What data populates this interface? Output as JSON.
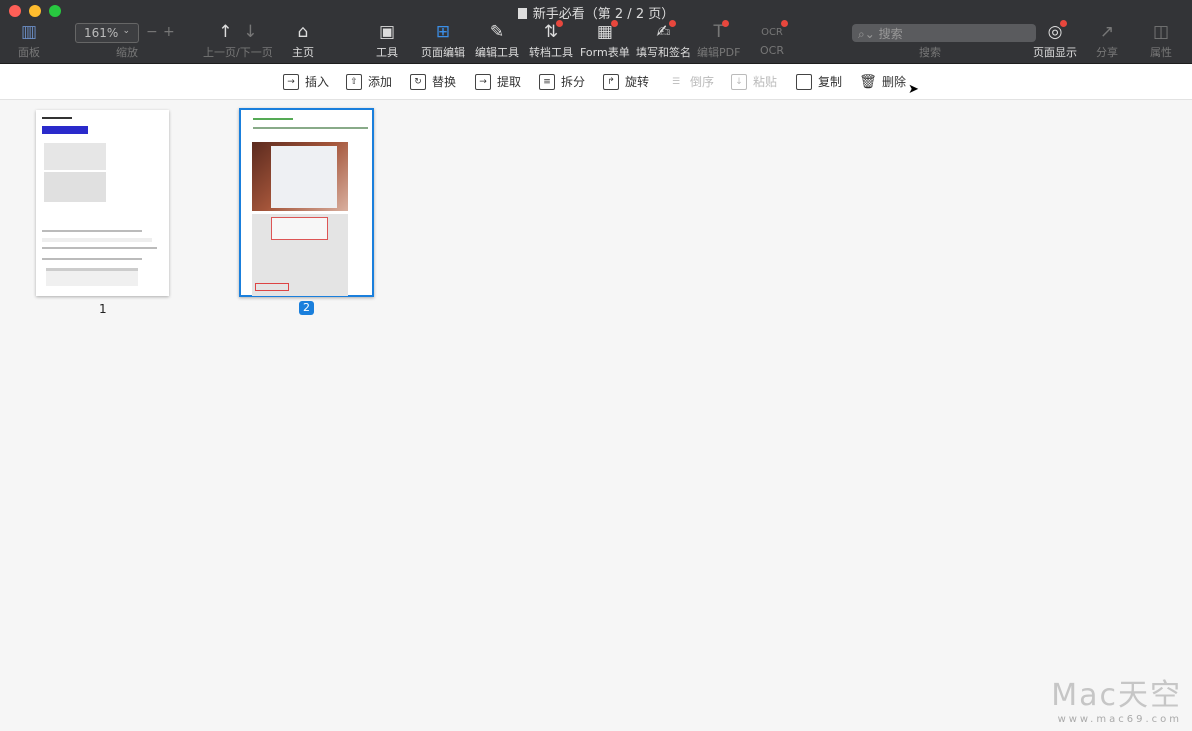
{
  "window": {
    "title": "新手必看（第 2 / 2 页）"
  },
  "toolbar": {
    "panel": "面板",
    "zoom_value": "161%",
    "zoom_label": "缩放",
    "zoom_minus": "−",
    "zoom_plus": "+",
    "prevnext": "上一页/下一页",
    "home": "主页",
    "tools": "工具",
    "page_edit": "页面编辑",
    "edit_tools": "编辑工具",
    "convert": "转档工具",
    "form": "Form表单",
    "fill_sign": "填写和签名",
    "edit_pdf": "编辑PDF",
    "ocr": "OCR",
    "search_placeholder": "搜索",
    "search_label": "搜索",
    "page_display": "页面显示",
    "share": "分享",
    "properties": "属性"
  },
  "page_tools": [
    {
      "label": "插入",
      "icon": "insert-icon",
      "enabled": true
    },
    {
      "label": "添加",
      "icon": "add-icon",
      "enabled": true
    },
    {
      "label": "替换",
      "icon": "replace-icon",
      "enabled": true
    },
    {
      "label": "提取",
      "icon": "extract-icon",
      "enabled": true
    },
    {
      "label": "拆分",
      "icon": "split-icon",
      "enabled": true
    },
    {
      "label": "旋转",
      "icon": "rotate-icon",
      "enabled": true
    },
    {
      "label": "倒序",
      "icon": "reverse-icon",
      "enabled": false
    },
    {
      "label": "粘贴",
      "icon": "paste-icon",
      "enabled": false
    },
    {
      "label": "复制",
      "icon": "copy-icon",
      "enabled": true
    },
    {
      "label": "删除",
      "icon": "delete-icon",
      "enabled": true
    }
  ],
  "pages": [
    {
      "number": "1",
      "selected": false
    },
    {
      "number": "2",
      "selected": true
    }
  ],
  "watermark": {
    "brand": "Mac天空",
    "url": "www.mac69.com"
  },
  "colors": {
    "accent": "#1a7fdc",
    "badge": "#e8473d"
  }
}
